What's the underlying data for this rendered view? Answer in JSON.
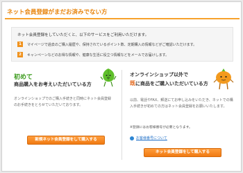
{
  "header": {
    "title": "ネット会員登録がまだお済みでない方"
  },
  "intro": {
    "text": "ネット会員登録をしていただくと、以下のサービスをご利用いただけます。",
    "benefits": [
      {
        "num": "1",
        "text": "マイページで過去のご購入履歴や、保持されているポイント数、定期購入の情報などがご確認いただけます。"
      },
      {
        "num": "2",
        "text": "キャンペーンなどのお得な情報や、健康な生活に役立つ情報などをメールでお届けします。"
      }
    ]
  },
  "left": {
    "heading1": "初めて",
    "heading2": "商品購入をお考えいただいている方",
    "body": "オンラインショップでのご購入手続きと同時にネット会員登録のお手続きをとらせていただいております。",
    "button": "新規ネット会員登録をして購入する"
  },
  "right": {
    "heading1": "オンラインショップ以外で",
    "heading2_accent": "既",
    "heading2_rest": "に商品をご購入いただいている方",
    "body": "以前、電話やFAX、郵送にてお申し込みをいただき、ネットでの購入手続きが初めての方はネット会員登録をお願いいたします。",
    "note": "※登録にはお客様番号が必要となります。",
    "faq_link": "お客様番号について",
    "button": "ネット会員登録をして購入する"
  },
  "colors": {
    "accent": "#f0921d",
    "green": "#3a9a1b",
    "orange_text": "#e36a1f",
    "link": "#1f6fc7"
  }
}
